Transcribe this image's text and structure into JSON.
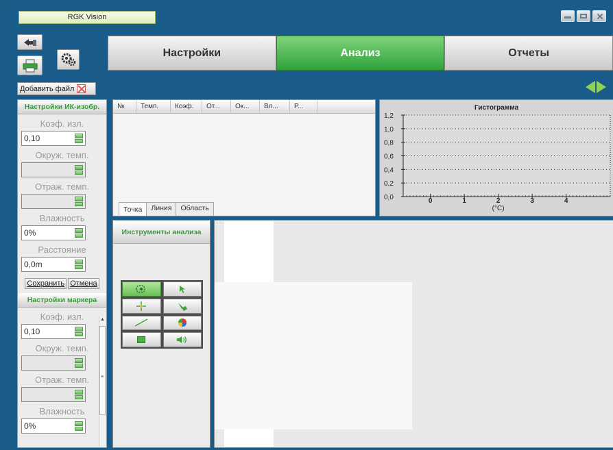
{
  "app": {
    "title": "RGK Vision"
  },
  "tabs": [
    {
      "label": "Настройки",
      "active": false
    },
    {
      "label": "Анализ",
      "active": true
    },
    {
      "label": "Отчеты",
      "active": false
    }
  ],
  "toolbar": {
    "add_file_label": "Добавить файл"
  },
  "ir_settings": {
    "title": "Настройки ИК-изобр.",
    "emissivity_label": "Коэф. изл.",
    "emissivity_value": "0,10",
    "ambient_label": "Окруж. темп.",
    "ambient_value": "",
    "reflected_label": "Отраж. темп.",
    "reflected_value": "",
    "humidity_label": "Влажность",
    "humidity_value": "0%",
    "distance_label": "Расстояние",
    "distance_value": "0,0m",
    "save_label": "Сохранить",
    "cancel_label": "Отмена"
  },
  "marker_settings": {
    "title": "Настройки маркера",
    "emissivity_label": "Коэф. изл.",
    "emissivity_value": "0,10",
    "ambient_label": "Окруж. темп.",
    "ambient_value": "",
    "reflected_label": "Отраж. темп.",
    "reflected_value": "",
    "humidity_label": "Влажность",
    "humidity_value": "0%"
  },
  "table": {
    "columns": [
      "№",
      "Темп.",
      "Коэф.",
      "От...",
      "Ок...",
      "Вл...",
      "Р..."
    ],
    "rows": [],
    "subtabs": [
      {
        "label": "Точка",
        "active": true
      },
      {
        "label": "Линия",
        "active": false
      },
      {
        "label": "Область",
        "active": false
      }
    ]
  },
  "tools": {
    "title": "Инструменты анализа",
    "items": [
      {
        "icon": "freeform-region-icon",
        "active": true
      },
      {
        "icon": "pointer-arrow-icon",
        "active": false
      },
      {
        "icon": "spot-point-icon",
        "active": false
      },
      {
        "icon": "eyedropper-icon",
        "active": false
      },
      {
        "icon": "line-icon",
        "active": false
      },
      {
        "icon": "color-palette-icon",
        "active": false
      },
      {
        "icon": "rectangle-area-icon",
        "active": false
      },
      {
        "icon": "speaker-icon",
        "active": false
      }
    ]
  },
  "colors": {
    "accent_green": "#2fa23a",
    "header_green_text": "#3d9a3a",
    "background_blue": "#1a5c89"
  },
  "chart_data": {
    "type": "bar",
    "title": "Гистограмма",
    "xlabel": "(°C)",
    "ylabel": "",
    "x_ticks": [
      "0",
      "1",
      "2",
      "3",
      "4"
    ],
    "y_ticks": [
      "0,0",
      "0,2",
      "0,4",
      "0,6",
      "0,8",
      "1,0",
      "1,2"
    ],
    "xlim": [
      -0.8,
      5.3
    ],
    "ylim": [
      0,
      1.2
    ],
    "grid": true,
    "categories": [],
    "values": []
  }
}
